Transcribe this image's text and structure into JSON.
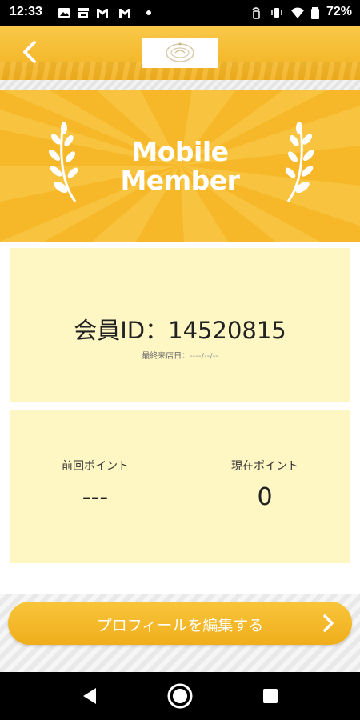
{
  "status_bar": {
    "time": "12:33",
    "battery": "72%",
    "icons": [
      "image-icon",
      "store-icon",
      "gmail-icon",
      "gmail-icon",
      "dot-icon",
      "phone-wifi-icon",
      "vibrate-icon",
      "wifi-icon",
      "battery-icon"
    ]
  },
  "header": {
    "back_icon": "chevron-left-icon",
    "logo": "shop-logo"
  },
  "banner": {
    "line1": "Mobile",
    "line2": "Member"
  },
  "member": {
    "id_label": "会員ID：",
    "id_value": "14520815",
    "last_visit_label": "最終来店日：",
    "last_visit_value": "----/--/--"
  },
  "points": {
    "previous_label": "前回ポイント",
    "previous_value": "---",
    "current_label": "現在ポイント",
    "current_value": "0"
  },
  "actions": {
    "edit_profile_label": "プロフィールを編集する"
  },
  "nav": {
    "back": "back-triangle-icon",
    "home": "home-circle-icon",
    "recents": "recents-square-icon"
  },
  "colors": {
    "accent": "#f3b01d",
    "card_bg": "#fef6c3",
    "status_bar": "#000000"
  }
}
